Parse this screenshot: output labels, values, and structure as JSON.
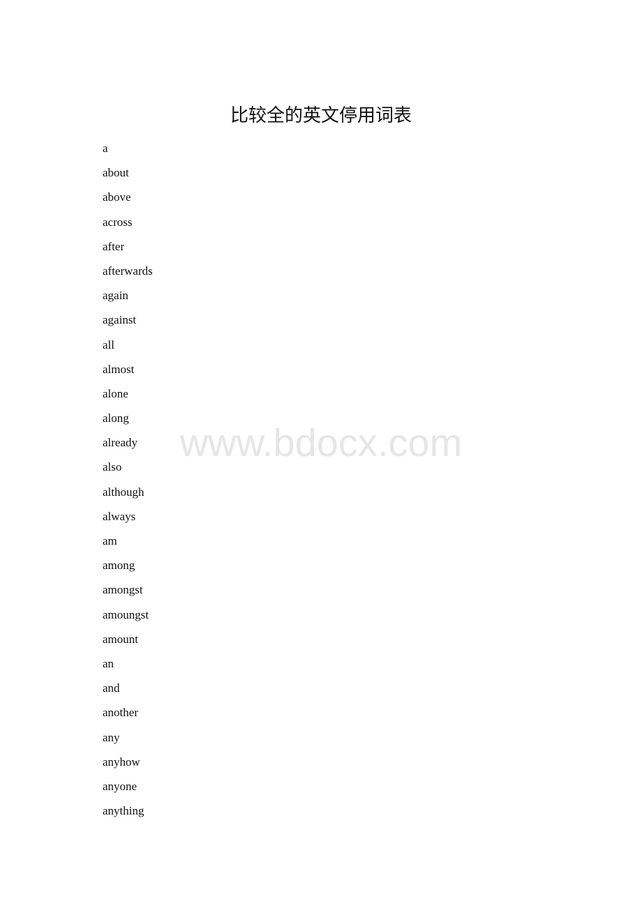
{
  "document": {
    "title": "比较全的英文停用词表",
    "watermark": "www.bdocx.com",
    "words": [
      "a",
      "about",
      "above",
      "across",
      "after",
      "afterwards",
      "again",
      "against",
      "all",
      "almost",
      "alone",
      "along",
      "already",
      "also",
      "although",
      "always",
      "am",
      "among",
      "amongst",
      "amoungst",
      "amount",
      "an",
      "and",
      "another",
      "any",
      "anyhow",
      "anyone",
      "anything"
    ]
  }
}
